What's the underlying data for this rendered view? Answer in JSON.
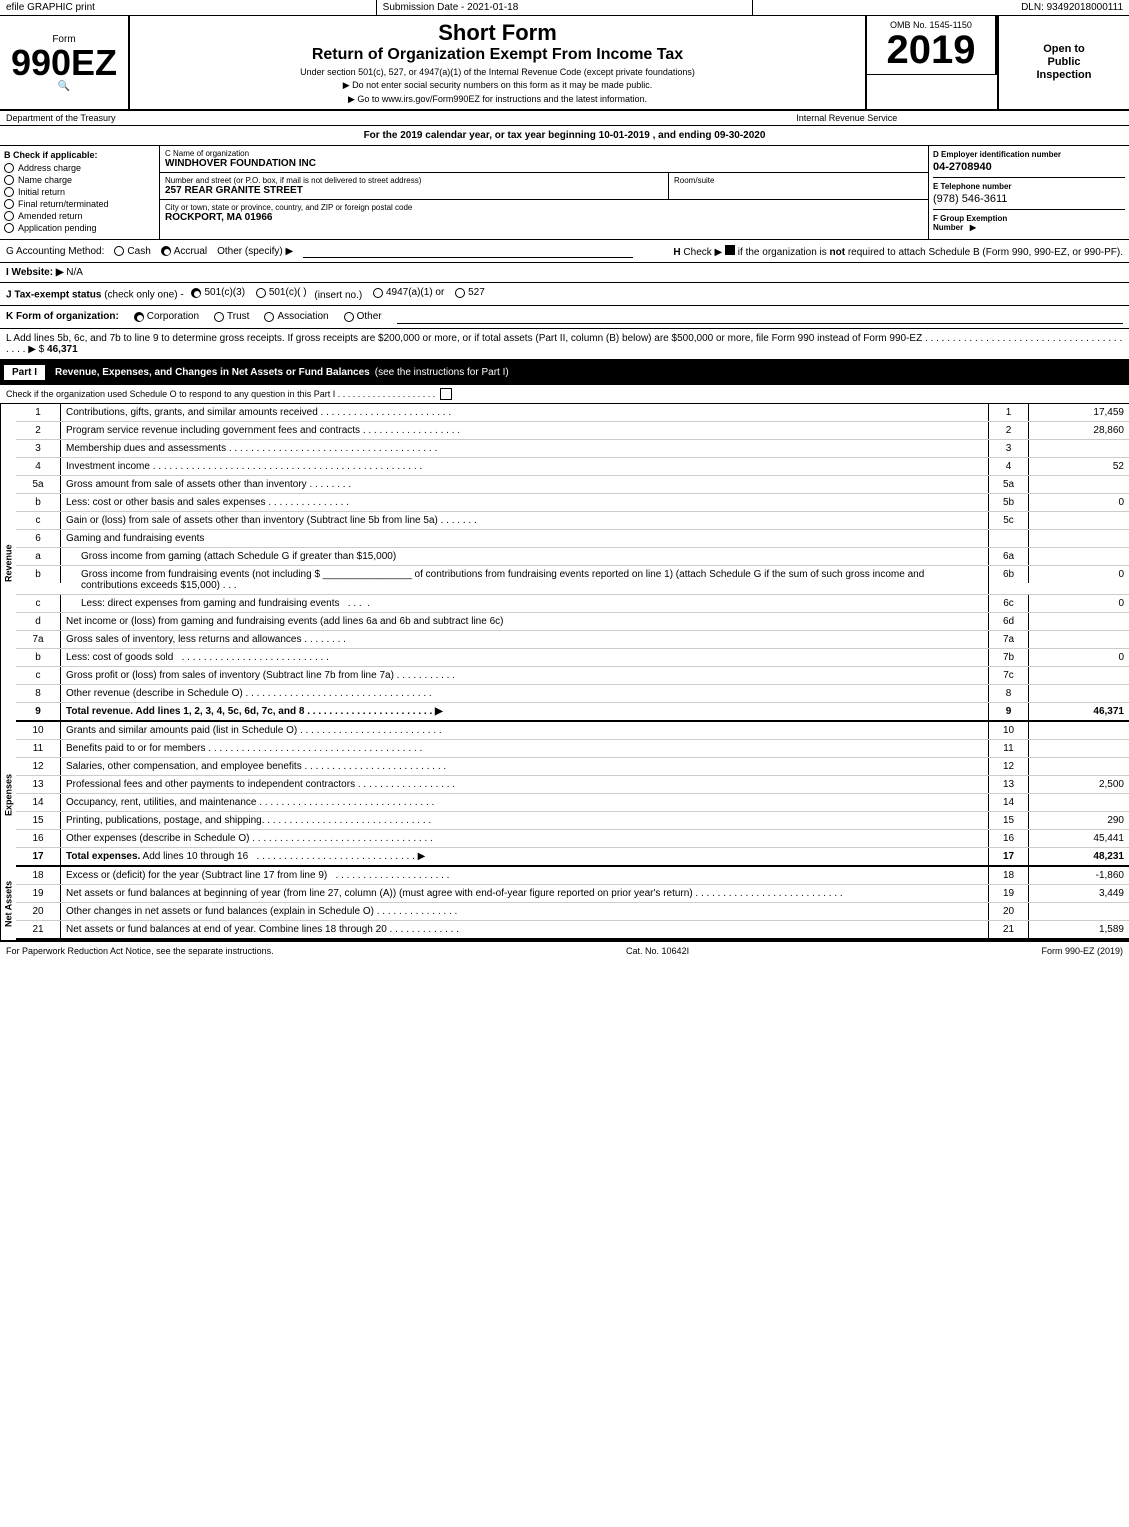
{
  "topbar": {
    "left": "efile GRAPHIC print",
    "mid": "Submission Date - 2021-01-18",
    "right": "DLN: 93492018000111"
  },
  "form": {
    "label": "Form",
    "number": "990EZ",
    "short_form": "Short Form",
    "return_title": "Return of Organization Exempt From Income Tax",
    "subtitle": "Under section 501(c), 527, or 4947(a)(1) of the Internal Revenue Code (except private foundations)",
    "no_ssn": "▶ Do not enter social security numbers on this form as it may be made public.",
    "goto": "▶ Go to www.irs.gov/Form990EZ for instructions and the latest information.",
    "omb": "OMB No. 1545-1150",
    "year": "2019",
    "open_line1": "Open to",
    "open_line2": "Public",
    "open_line3": "Inspection",
    "dept": "Department of the Treasury",
    "irs": "Internal Revenue Service"
  },
  "tax_year": {
    "text": "For the 2019 calendar year, or tax year beginning 10-01-2019 , and ending 09-30-2020"
  },
  "check_if": {
    "label": "B Check if applicable:",
    "items": [
      "Address change",
      "Name change",
      "Initial return",
      "Final return/terminated",
      "Amended return",
      "Application pending"
    ]
  },
  "org": {
    "name_label": "C Name of organization",
    "name_value": "WINDHOVER FOUNDATION INC",
    "address_label": "Number and street (or P.O. box, if mail is not delivered to street address)",
    "address_value": "257 REAR GRANITE STREET",
    "room_label": "Room/suite",
    "room_value": "",
    "city_label": "City or town, state or province, country, and ZIP or foreign postal code",
    "city_value": "ROCKPORT, MA  01966",
    "ein_label": "D Employer identification number",
    "ein_value": "04-2708940",
    "phone_label": "E Telephone number",
    "phone_value": "(978) 546-3611",
    "group_label": "F Group Exemption Number",
    "group_value": ""
  },
  "accounting": {
    "label": "G Accounting Method:",
    "cash": "Cash",
    "accrual": "Accrual",
    "other": "Other (specify) ▶"
  },
  "website": {
    "label": "I Website: ▶",
    "value": "N/A"
  },
  "tax_status": {
    "label": "J Tax-exempt status (check only one) -",
    "s501c3": "501(c)(3)",
    "s501c": "501(c)(  )",
    "insert": "(insert no.)",
    "s4947": "4947(a)(1) or",
    "s527": "527"
  },
  "form_org": {
    "label": "K Form of organization:",
    "corporation": "Corporation",
    "trust": "Trust",
    "association": "Association",
    "other": "Other"
  },
  "line_l": {
    "text": "L Add lines 5b, 6c, and 7b to line 9 to determine gross receipts. If gross receipts are $200,000 or more, or if total assets (Part II, column (B) below) are $500,000 or more, file Form 990 instead of Form 990-EZ  . . . . . . . . . . . . . . . . . . . . . . . . . . . . . . . . . . . . . . . . ▶ $",
    "value": "46,371"
  },
  "part1": {
    "title": "Part I",
    "subtitle": "Revenue, Expenses, and Changes in Net Assets or Fund Balances",
    "instructions": "(see the instructions for Part I)",
    "check_if": "Check if the organization used Schedule O to respond to any question in this Part I . . . . . . . . . . . . . . . . . . . .",
    "rows": [
      {
        "num": "1",
        "label": "Contributions, gifts, grants, and similar amounts received . . . . . . . . . . . . . . . . . . . . . . . .",
        "line": "1",
        "value": "17,459"
      },
      {
        "num": "2",
        "label": "Program service revenue including government fees and contracts . . . . . . . . . . . . . . . . . .",
        "line": "2",
        "value": "28,860"
      },
      {
        "num": "3",
        "label": "Membership dues and assessments . . . . . . . . . . . . . . . . . . . . . . . . . . . . . . . . . . . . . .",
        "line": "3",
        "value": ""
      },
      {
        "num": "4",
        "label": "Investment income . . . . . . . . . . . . . . . . . . . . . . . . . . . . . . . . . . . . . . . . . . . . . . . . .",
        "line": "4",
        "value": "52"
      },
      {
        "num": "5a",
        "label": "Gross amount from sale of assets other than inventory . . . . . . . .",
        "sub": "5a",
        "sub_value": ""
      },
      {
        "num": "5b",
        "label": "Less: cost or other basis and sales expenses . . . . . . . . . . . . . .",
        "sub": "5b",
        "sub_value": "0"
      },
      {
        "num": "5c",
        "label": "Gain or (loss) from sale of assets other than inventory (Subtract line 5b from line 5a) . . . . . . .",
        "line": "5c",
        "value": ""
      },
      {
        "num": "6",
        "label": "Gaming and fundraising events",
        "no_dots": true
      },
      {
        "num": "6a",
        "label": "Gross income from gaming (attach Schedule G if greater than $15,000)",
        "sub": "6a",
        "sub_value": "",
        "indent": true
      },
      {
        "num": "6b_label",
        "label": "Gross income from fundraising events (not including $ ________________ of contributions from fundraising events reported on line 1) (attach Schedule G if the sum of such gross income and contributions exceeds $15,000) . . .",
        "sub": "6b",
        "sub_value": "0",
        "indent": true,
        "multiline": true
      },
      {
        "num": "6c",
        "label": "Less: direct expenses from gaming and fundraising events . . . . .",
        "sub": "6c",
        "sub_value": "0",
        "indent": true
      },
      {
        "num": "6d",
        "label": "Net income or (loss) from gaming and fundraising events (add lines 6a and 6b and subtract line 6c)",
        "line": "6d",
        "value": ""
      },
      {
        "num": "7a",
        "label": "Gross sales of inventory, less returns and allowances . . . . . . . .",
        "sub": "7a",
        "sub_value": ""
      },
      {
        "num": "7b",
        "label": "Less: cost of goods sold . . . . . . . . . . . . . . . . . . . . . . . . . . .",
        "sub": "7b",
        "sub_value": "0"
      },
      {
        "num": "7c",
        "label": "Gross profit or (loss) from sales of inventory (Subtract line 7b from line 7a) . . . . . . . . . . .",
        "line": "7c",
        "value": ""
      },
      {
        "num": "8",
        "label": "Other revenue (describe in Schedule O) . . . . . . . . . . . . . . . . . . . . . . . . . . . . . . . . . .",
        "line": "8",
        "value": ""
      },
      {
        "num": "9",
        "label": "Total revenue. Add lines 1, 2, 3, 4, 5c, 6d, 7c, and 8 . . . . . . . . . . . . . . . . . . . . . . . ▶",
        "line": "9",
        "value": "46,371",
        "bold": true
      }
    ]
  },
  "expenses": {
    "rows": [
      {
        "num": "10",
        "label": "Grants and similar amounts paid (list in Schedule O) . . . . . . . . . . . . . . . . . . . . . . . . . .",
        "line": "10",
        "value": ""
      },
      {
        "num": "11",
        "label": "Benefits paid to or for members . . . . . . . . . . . . . . . . . . . . . . . . . . . . . . . . . . . . . . .",
        "line": "11",
        "value": ""
      },
      {
        "num": "12",
        "label": "Salaries, other compensation, and employee benefits . . . . . . . . . . . . . . . . . . . . . . . . . .",
        "line": "12",
        "value": ""
      },
      {
        "num": "13",
        "label": "Professional fees and other payments to independent contractors . . . . . . . . . . . . . . . . . .",
        "line": "13",
        "value": "2,500"
      },
      {
        "num": "14",
        "label": "Occupancy, rent, utilities, and maintenance . . . . . . . . . . . . . . . . . . . . . . . . . . . . . . . .",
        "line": "14",
        "value": ""
      },
      {
        "num": "15",
        "label": "Printing, publications, postage, and shipping. . . . . . . . . . . . . . . . . . . . . . . . . . . . . . .",
        "line": "15",
        "value": "290"
      },
      {
        "num": "16",
        "label": "Other expenses (describe in Schedule O) . . . . . . . . . . . . . . . . . . . . . . . . . . . . . . . . .",
        "line": "16",
        "value": "45,441"
      },
      {
        "num": "17",
        "label": "Total expenses. Add lines 10 through 16 . . . . . . . . . . . . . . . . . . . . . . . . . . . . . . ▶",
        "line": "17",
        "value": "48,231",
        "bold": true
      }
    ]
  },
  "net_assets": {
    "rows": [
      {
        "num": "18",
        "label": "Excess or (deficit) for the year (Subtract line 17 from line 9) . . . . . . . . . . . . . . . . . . . . .",
        "line": "18",
        "value": "-1,860"
      },
      {
        "num": "19",
        "label": "Net assets or fund balances at beginning of year (from line 27, column (A)) (must agree with end-of-year figure reported on prior year's return) . . . . . . . . . . . . . . . . . . . . . . . . . . .",
        "line": "19",
        "value": "3,449"
      },
      {
        "num": "20",
        "label": "Other changes in net assets or fund balances (explain in Schedule O) . . . . . . . . . . . . . . .",
        "line": "20",
        "value": ""
      },
      {
        "num": "21",
        "label": "Net assets or fund balances at end of year. Combine lines 18 through 20 . . . . . . . . . . . . .",
        "line": "21",
        "value": "1,589"
      }
    ]
  },
  "footer": {
    "left": "For Paperwork Reduction Act Notice, see the separate instructions.",
    "mid": "Cat. No. 10642I",
    "right": "Form 990-EZ (2019)"
  }
}
